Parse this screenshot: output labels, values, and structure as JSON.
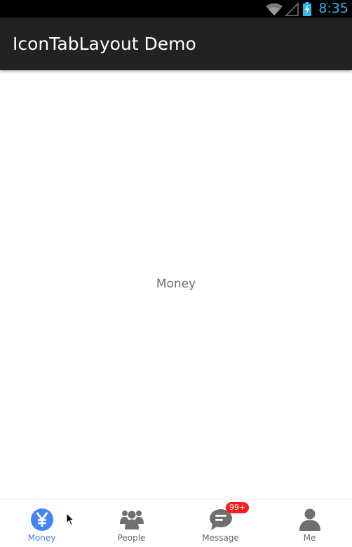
{
  "status_bar": {
    "time": "8:35",
    "icons": [
      "wifi-icon",
      "signal-icon",
      "battery-charging-icon"
    ],
    "clock_color": "#33b5e5"
  },
  "action_bar": {
    "title": "IconTabLayout Demo",
    "background": "#222222"
  },
  "content": {
    "text": "Money"
  },
  "tabs": [
    {
      "label": "Money",
      "icon": "yen-icon",
      "active": true
    },
    {
      "label": "People",
      "icon": "people-icon",
      "active": false
    },
    {
      "label": "Message",
      "icon": "message-icon",
      "active": false,
      "badge": "99+"
    },
    {
      "label": "Me",
      "icon": "person-icon",
      "active": false
    }
  ],
  "colors": {
    "accent": "#4285f4",
    "inactive": "#666666",
    "badge": "#ff1a1a"
  }
}
